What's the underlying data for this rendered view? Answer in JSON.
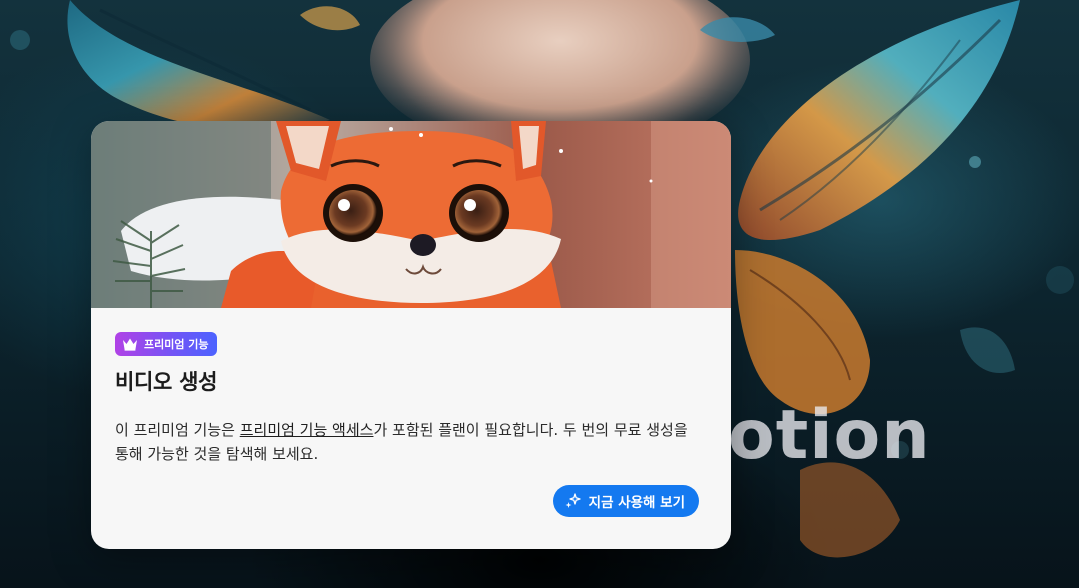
{
  "background": {
    "overlay_word": "otion"
  },
  "card": {
    "badge": {
      "icon": "crown-icon",
      "label": "프리미엄 기능",
      "gradient": [
        "#b142e6",
        "#4c63ff"
      ]
    },
    "title": "비디오 생성",
    "description": {
      "prefix": "이 프리미엄 기능은 ",
      "link_text": "프리미엄 기능 액세스",
      "suffix": "가 포함된 플랜이 필요합니다. 두 번의 무료 생성을 통해 가능한 것을 탐색해 보세요."
    },
    "cta": {
      "icon": "sparkle-icon",
      "label": "지금 사용해 보기",
      "color": "#1479f0"
    }
  }
}
